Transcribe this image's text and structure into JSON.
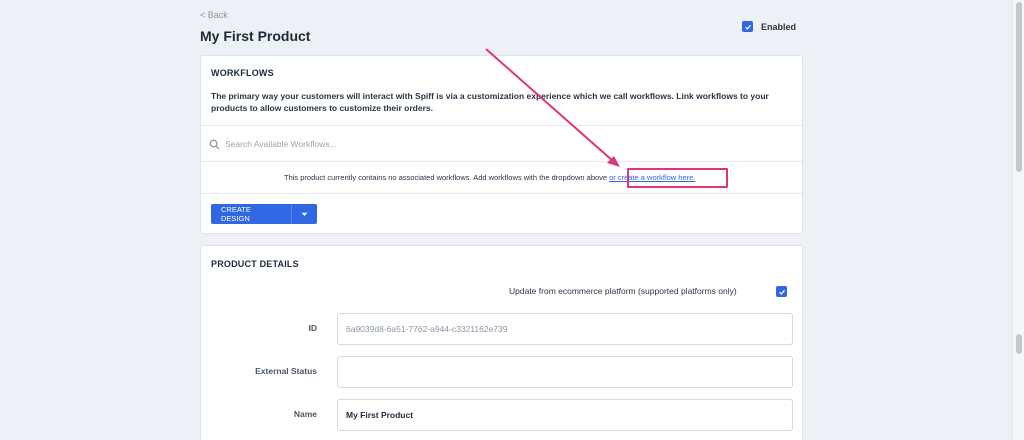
{
  "header": {
    "back_label": "< Back",
    "title": "My First Product",
    "enabled_label": "Enabled",
    "enabled_checked": true
  },
  "workflows": {
    "heading": "WORKFLOWS",
    "description": "The primary way your customers will interact with Spiff is via a customization experience which we call workflows. Link workflows to your products to allow customers to customize their orders.",
    "search_placeholder": "Search Available Workflows...",
    "notice_text": "This product currently contains no associated workflows. Add workflows with the dropdown above",
    "notice_link": "or create a workflow here.",
    "create_button": "CREATE DESIGN"
  },
  "product_details": {
    "heading": "PRODUCT DETAILS",
    "update_label": "Update from ecommerce platform (supported platforms only)",
    "update_checked": true,
    "fields": [
      {
        "label": "ID",
        "value": "6a9039d8-6a51-7762-a944-c3321162e739"
      },
      {
        "label": "External Status",
        "value": ""
      },
      {
        "label": "Name",
        "value": "My First Product"
      }
    ]
  },
  "colors": {
    "accent": "#3167e3",
    "annotation": "#e0347a",
    "background": "#edf0f4"
  }
}
